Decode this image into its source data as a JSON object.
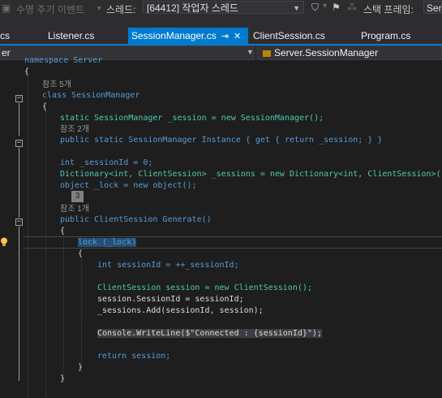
{
  "debug_toolbar": {
    "lifecycle_events": "수명 주기 이벤트",
    "thread_label": "스레드:",
    "thread_value": "[64412] 작업자 스레드",
    "stack_frame_label": "스택 프레임:",
    "stack_frame_value": "Ser"
  },
  "tabs": [
    {
      "label": "cs",
      "active": false
    },
    {
      "label": "Listener.cs",
      "active": false
    },
    {
      "label": "SessionManager.cs",
      "active": true
    },
    {
      "label": "ClientSession.cs",
      "active": false
    },
    {
      "label": "Program.cs",
      "active": false
    }
  ],
  "navbar": {
    "left_scope": "er",
    "member_scope": "Server.SessionManager"
  },
  "code": {
    "line_namespace": "namespace Server",
    "brace_open_ns": "{",
    "refs_class": "참조 5개",
    "line_class": "class SessionManager",
    "brace_open_class": "{",
    "line_static_session": "static SessionManager _session = new SessionManager();",
    "refs_instance": "참조 2개",
    "line_instance": "public static SessionManager Instance { get { return _session; } }",
    "line_session_id": "int _sessionId = 0;",
    "line_dictionary": "Dictionary<int, ClientSession> _sessions = new Dictionary<int, ClientSession>();",
    "line_lock": "object _lock = new object();",
    "tooltip_count": "3",
    "refs_generate": "참조 1개",
    "line_generate": "public ClientSession Generate()",
    "brace_open_method": "{",
    "line_lock_stmt": "lock (_lock)",
    "brace_open_lock": "{",
    "line_int_session": "int sessionId = ++_sessionId;",
    "line_new_session": "ClientSession session = new ClientSession();",
    "line_set_id": "session.SessionId = sessionId;",
    "line_add": "_sessions.Add(sessionId, session);",
    "line_console": "Console.WriteLine($\"Connected : {sessionId}\");",
    "line_return": "return session;",
    "brace_close_lock": "}",
    "brace_close_method": "}"
  }
}
